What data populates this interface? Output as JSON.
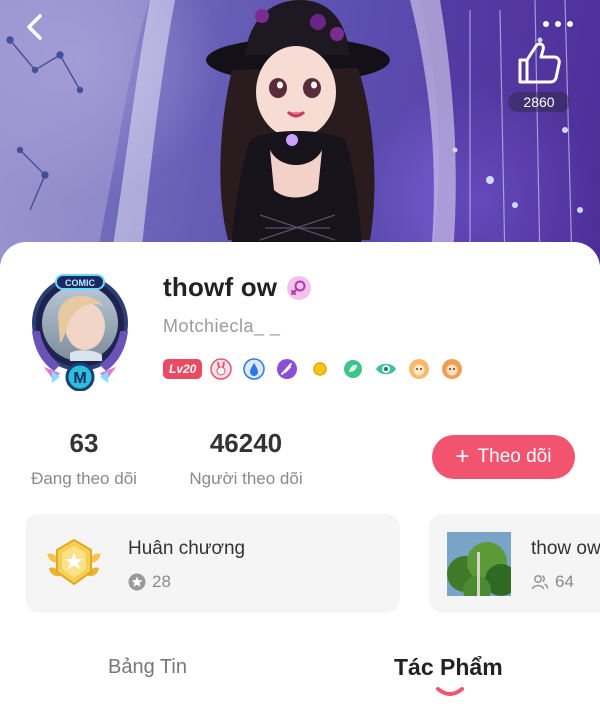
{
  "header": {
    "like_count": "2860"
  },
  "profile": {
    "username": "thowf ow",
    "handle": "Motchiecla_ _",
    "level_badge": "Lv20",
    "frame_brand_text": "COMIC",
    "frame_letter": "M",
    "badges": [
      "rabbit-badge",
      "water-drop-badge",
      "feather-badge",
      "coin-badge",
      "leaf-badge",
      "eye-badge",
      "lion-badge-1",
      "lion-badge-2"
    ]
  },
  "stats": {
    "following_count": "63",
    "following_label": "Đang theo dõi",
    "followers_count": "46240",
    "followers_label": "Người theo dõi"
  },
  "actions": {
    "follow_label": "Theo dõi",
    "follow_icon": "plus"
  },
  "cards": {
    "medal": {
      "title": "Huân chương",
      "count": "28"
    },
    "work": {
      "title": "thow ow",
      "count": "64"
    }
  },
  "tabs": {
    "feed": "Bảng Tin",
    "works": "Tác Phẩm",
    "active": "works"
  },
  "colors": {
    "accent": "#f25470",
    "level_badge": "#ea4a63",
    "banner": "#5b4fb0"
  }
}
